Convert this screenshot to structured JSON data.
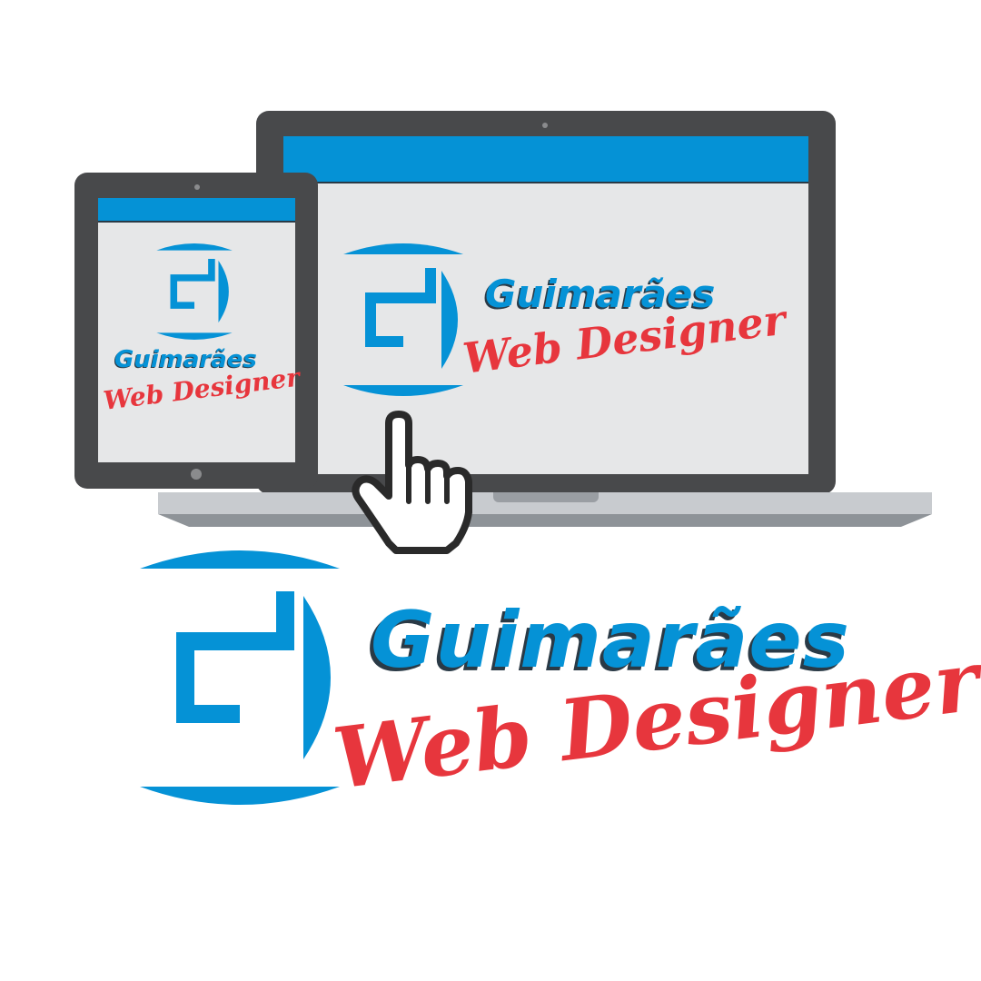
{
  "brand": {
    "name": "Guimarães",
    "tagline": "Web Designer"
  },
  "colors": {
    "primary_blue": "#0592d6",
    "accent_red": "#e7363d",
    "device_frame": "#48494b",
    "screen_bg": "#e6e7e8",
    "laptop_base": "#c8cbcf"
  },
  "icons": {
    "logo_emblem": "g-emblem-icon",
    "pointer": "hand-pointer-icon"
  }
}
